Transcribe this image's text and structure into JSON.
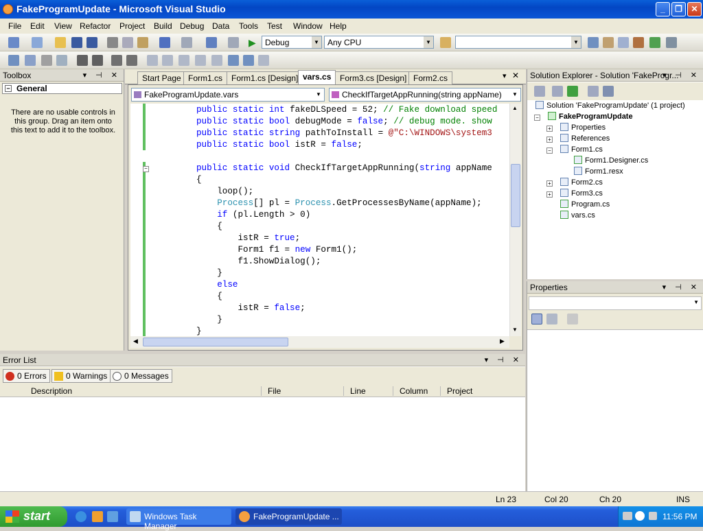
{
  "window": {
    "title": "FakeProgramUpdate - Microsoft Visual Studio"
  },
  "menu": [
    "File",
    "Edit",
    "View",
    "Refactor",
    "Project",
    "Build",
    "Debug",
    "Data",
    "Tools",
    "Test",
    "Window",
    "Help"
  ],
  "toolbar": {
    "config": "Debug",
    "platform": "Any CPU",
    "find": ""
  },
  "toolbox": {
    "title": "Toolbox",
    "group": "General",
    "message": "There are no usable controls in this group. Drag an item onto this text to add it to the toolbox."
  },
  "doc_tabs": [
    "Start Page",
    "Form1.cs",
    "Form1.cs [Design]",
    "vars.cs",
    "Form3.cs [Design]",
    "Form2.cs"
  ],
  "active_tab": "vars.cs",
  "editor": {
    "type_combo": "FakeProgramUpdate.vars",
    "member_combo": "CheckIfTargetAppRunning(string appName)",
    "lines": [
      "public static int fakeDLSpeed = 52; // Fake download speed",
      "public static bool debugMode = false; // debug mode. show",
      "public static string pathToInstall = @\"C:\\WINDOWS\\system3",
      "public static bool istR = false;",
      "",
      "public static void CheckIfTargetAppRunning(string appName",
      "{",
      "    loop();",
      "    Process[] pl = Process.GetProcessesByName(appName);",
      "    if (pl.Length > 0)",
      "    {",
      "        istR = true;",
      "        Form1 f1 = new Form1();",
      "        f1.ShowDialog();",
      "    }",
      "    else",
      "    {",
      "        istR = false;",
      "    }",
      "}"
    ]
  },
  "solution_explorer": {
    "title": "Solution Explorer - Solution 'FakeProgr...",
    "solution": "Solution 'FakeProgramUpdate' (1 project)",
    "project": "FakeProgramUpdate",
    "items": [
      "Properties",
      "References",
      "Form1.cs",
      "Form1.Designer.cs",
      "Form1.resx",
      "Form2.cs",
      "Form3.cs",
      "Program.cs",
      "vars.cs"
    ]
  },
  "properties": {
    "title": "Properties"
  },
  "error_list": {
    "title": "Error List",
    "errors": "0 Errors",
    "warnings": "0 Warnings",
    "messages": "0 Messages",
    "columns": [
      "Description",
      "File",
      "Line",
      "Column",
      "Project"
    ]
  },
  "status": {
    "ln": "Ln 23",
    "col": "Col 20",
    "ch": "Ch 20",
    "mode": "INS"
  },
  "taskbar": {
    "start": "start",
    "tasks": [
      "Windows Task Manager",
      "FakeProgramUpdate ..."
    ],
    "clock": "11:56 PM"
  }
}
